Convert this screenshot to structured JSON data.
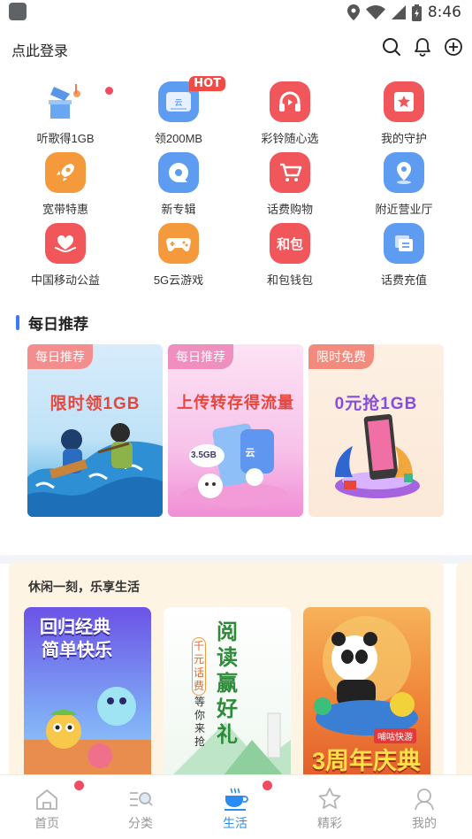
{
  "status_bar": {
    "time": "8:46"
  },
  "header": {
    "login_label": "点此登录"
  },
  "grid": {
    "items": [
      {
        "label": "听歌得1GB",
        "icon": "music-gift-icon"
      },
      {
        "label": "领200MB",
        "icon": "cloud-disk-icon",
        "badge": "HOT"
      },
      {
        "label": "彩铃随心选",
        "icon": "headphone-icon"
      },
      {
        "label": "我的守护",
        "icon": "star-shield-icon"
      },
      {
        "label": "宽带特惠",
        "icon": "rocket-icon"
      },
      {
        "label": "新专辑",
        "icon": "album-icon"
      },
      {
        "label": "话费购物",
        "icon": "cart-icon"
      },
      {
        "label": "附近营业厅",
        "icon": "location-icon"
      },
      {
        "label": "中国移动公益",
        "icon": "heart-hand-icon"
      },
      {
        "label": "5G云游戏",
        "icon": "gamepad-icon"
      },
      {
        "label": "和包钱包",
        "icon": "wallet-icon",
        "glyph": "和包"
      },
      {
        "label": "话费充值",
        "icon": "recharge-icon"
      }
    ]
  },
  "daily": {
    "title": "每日推荐",
    "cards": [
      {
        "tag": "每日推荐",
        "title": "限时领1GB"
      },
      {
        "tag": "每日推荐",
        "title": "上传转存得流量",
        "art_label": "3.5GB"
      },
      {
        "tag": "限时免费",
        "title": "0元抢1GB"
      }
    ]
  },
  "leisure": {
    "title": "休闲一刻，乐享生活",
    "posters": [
      {
        "line1": "回归经典",
        "line2": "简单快乐"
      },
      {
        "big": [
          "阅",
          "读",
          "赢",
          "好",
          "礼"
        ],
        "side": [
          "千",
          "元",
          "话",
          "费"
        ],
        "side2": [
          "等",
          "你",
          "来",
          "抢"
        ]
      },
      {
        "tag": "哺咕快游",
        "headline": "3周年庆典"
      }
    ]
  },
  "nav": [
    {
      "label": "首页",
      "icon": "home-icon"
    },
    {
      "label": "分类",
      "icon": "category-icon"
    },
    {
      "label": "生活",
      "icon": "life-cup-icon"
    },
    {
      "label": "精彩",
      "icon": "star-icon"
    },
    {
      "label": "我的",
      "icon": "profile-icon"
    }
  ],
  "colors": {
    "accent": "#2a8cf2",
    "badge_red": "#f04b45",
    "icon_blue": "#5d9cf0",
    "icon_red": "#f0565a",
    "icon_orange": "#f59a3c"
  }
}
